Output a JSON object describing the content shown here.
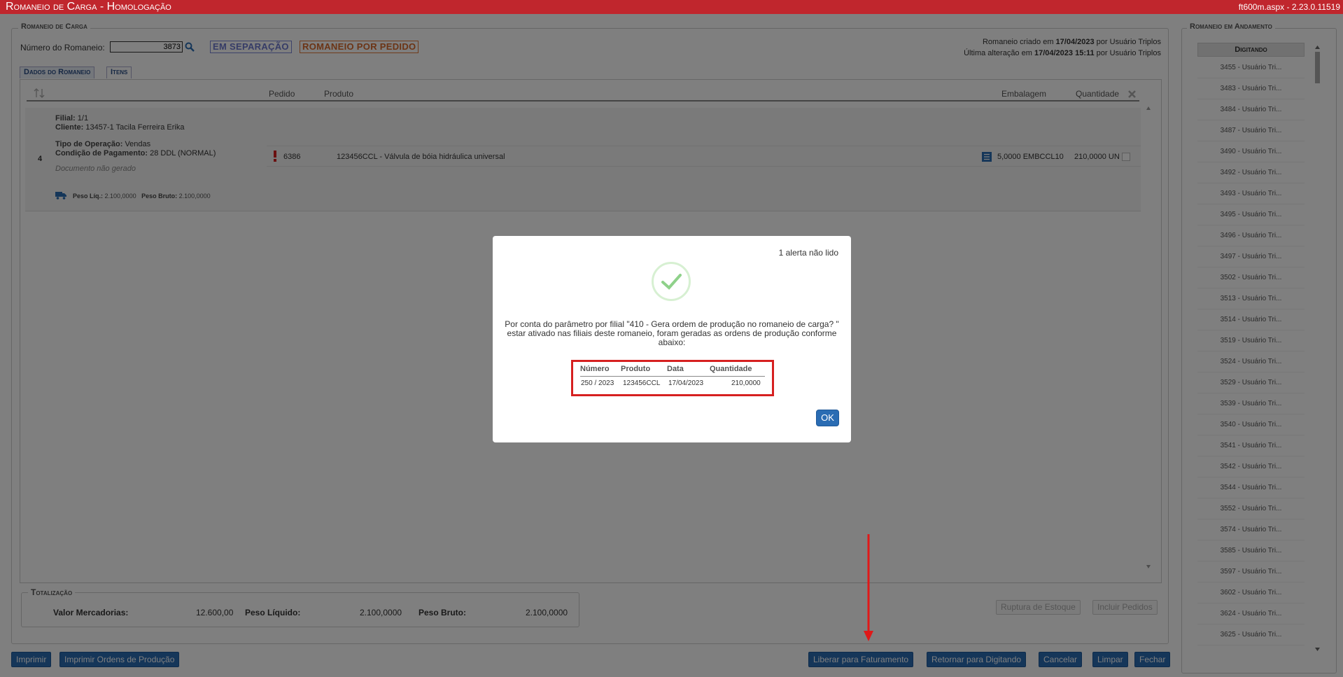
{
  "app": {
    "title": "Romaneio de Carga  - Homologação",
    "version": "ft600m.aspx - 2.23.0.11519"
  },
  "romaneio": {
    "section_label": "Romaneio de Carga",
    "numero_label": "Número do Romaneio:",
    "numero_value": "3873",
    "status_badge": "EM SEPARAÇÃO",
    "type_badge": "ROMANEIO POR PEDIDO",
    "created_prefix": "Romaneio criado em",
    "created_date": "17/04/2023",
    "created_by": "por Usuário Triplos",
    "altered_prefix": "Última alteração em",
    "altered_date": "17/04/2023 15:11",
    "altered_by": "por Usuário Triplos"
  },
  "tabs": [
    {
      "label": "Dados do Romaneio"
    },
    {
      "label": "Itens"
    }
  ],
  "grid": {
    "headers": {
      "pedido": "Pedido",
      "produto": "Produto",
      "embalagem": "Embalagem",
      "quantidade": "Quantidade"
    },
    "row": {
      "index": "4",
      "filial_label": "Filial:",
      "filial_value": "1/1",
      "cliente_label": "Cliente:",
      "cliente_value": "13457-1 Tacila Ferreira Erika",
      "tipo_label": "Tipo de Operação:",
      "tipo_value": "Vendas",
      "cond_label": "Condição de Pagamento:",
      "cond_value": "28 DDL (NORMAL)",
      "doc_status": "Documento não gerado",
      "peso_liq_label": "Peso Líq.:",
      "peso_liq_value": "2.100,0000",
      "peso_bruto_label": "Peso Bruto:",
      "peso_bruto_value": "2.100,0000",
      "pedido": "6386",
      "produto": "123456CCL - Válvula de bóia hidráulica universal",
      "embalagem": "5,0000 EMBCCL10",
      "quantidade": "210,0000 UN"
    }
  },
  "totalizacao": {
    "label": "Totalização",
    "valor_label": "Valor Mercadorias:",
    "valor_value": "12.600,00",
    "peso_liq_label": "Peso Líquido:",
    "peso_liq_value": "2.100,0000",
    "peso_bruto_label": "Peso Bruto:",
    "peso_bruto_value": "2.100,0000"
  },
  "buttons": {
    "ruptura": "Ruptura de Estoque",
    "incluir": "Incluir Pedidos",
    "imprimir": "Imprimir",
    "imprimir_ordens": "Imprimir Ordens de Produção",
    "liberar": "Liberar para Faturamento",
    "retornar": "Retornar para Digitando",
    "cancelar": "Cancelar",
    "limpar": "Limpar",
    "fechar": "Fechar"
  },
  "sidebar": {
    "title": "Romaneio em Andamento",
    "column": "Digitando",
    "items": [
      "3455 - Usuário Tri...",
      "3483 - Usuário Tri...",
      "3484 - Usuário Tri...",
      "3487 - Usuário Tri...",
      "3490 - Usuário Tri...",
      "3492 - Usuário Tri...",
      "3493 - Usuário Tri...",
      "3495 - Usuário Tri...",
      "3496 - Usuário Tri...",
      "3497 - Usuário Tri...",
      "3502 - Usuário Tri...",
      "3513 - Usuário Tri...",
      "3514 - Usuário Tri...",
      "3519 - Usuário Tri...",
      "3524 - Usuário Tri...",
      "3529 - Usuário Tri...",
      "3539 - Usuário Tri...",
      "3540 - Usuário Tri...",
      "3541 - Usuário Tri...",
      "3542 - Usuário Tri...",
      "3544 - Usuário Tri...",
      "3552 - Usuário Tri...",
      "3574 - Usuário Tri...",
      "3585 - Usuário Tri...",
      "3597 - Usuário Tri...",
      "3602 - Usuário Tri...",
      "3624 - Usuário Tri...",
      "3625 - Usuário Tri..."
    ]
  },
  "modal": {
    "alert_text": "1 alerta não lido",
    "message_line1": "Por conta do parâmetro por filial \"410 - Gera ordem de produção no romaneio de carga? \"",
    "message_line2": "estar ativado nas filiais deste romaneio, foram geradas as ordens de produção conforme",
    "message_line3": "abaixo:",
    "table_headers": [
      "Número",
      "Produto",
      "Data",
      "Quantidade"
    ],
    "table_row": [
      "250 / 2023",
      "123456CCL",
      "17/04/2023",
      "210,0000"
    ],
    "ok_label": "OK"
  },
  "colors": {
    "titlebar": "#c0262d",
    "primary_button": "#2a6cb3",
    "highlight_box": "#d62020",
    "check_green": "#8fd18a"
  }
}
